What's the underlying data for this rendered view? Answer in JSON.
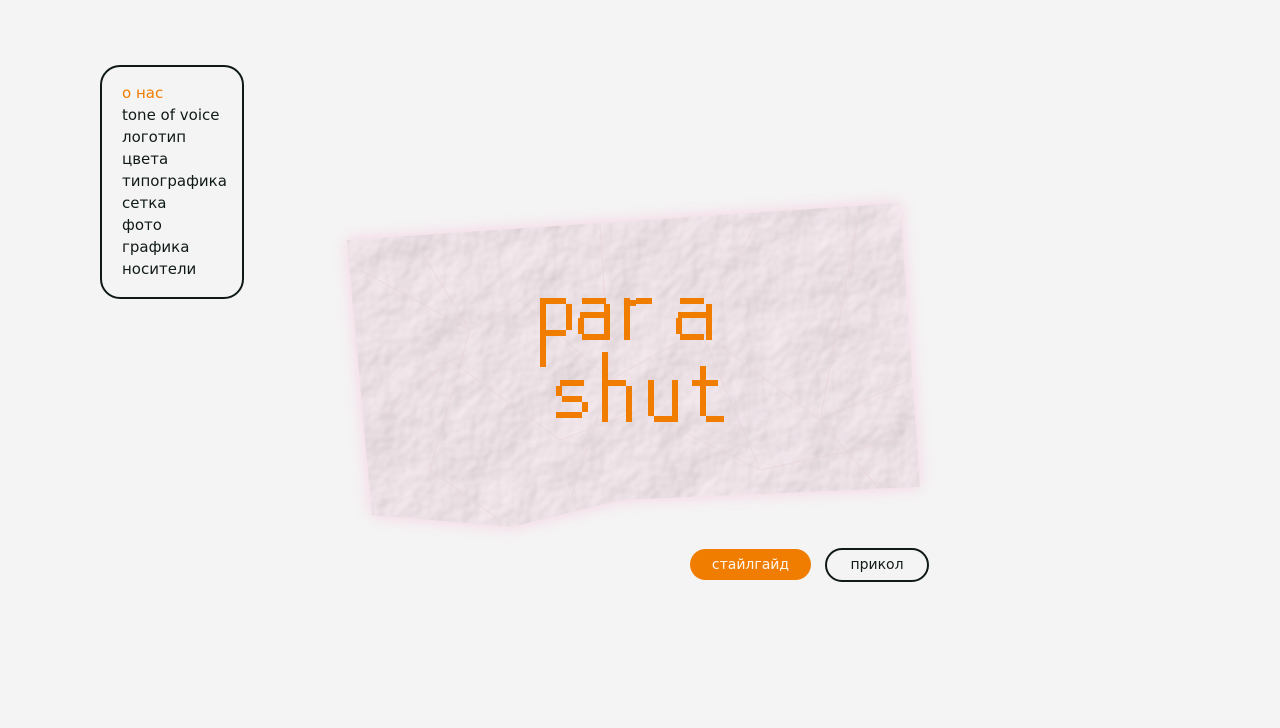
{
  "nav": {
    "items": [
      {
        "label": "о нас",
        "active": true
      },
      {
        "label": "tone of voice",
        "active": false
      },
      {
        "label": "логотип",
        "active": false
      },
      {
        "label": "цвета",
        "active": false
      },
      {
        "label": "типографика",
        "active": false
      },
      {
        "label": "сетка",
        "active": false
      },
      {
        "label": "фото",
        "active": false
      },
      {
        "label": "графика",
        "active": false
      },
      {
        "label": "носители",
        "active": false
      }
    ]
  },
  "hero": {
    "logo_line1": "para",
    "logo_line2": "shut"
  },
  "actions": {
    "primary_label": "стайлгайд",
    "secondary_label": "прикол"
  },
  "colors": {
    "background": "#f4f4f4",
    "accent": "#f07d00",
    "ink": "#0f1a14",
    "paper": "#f7e6ec"
  }
}
